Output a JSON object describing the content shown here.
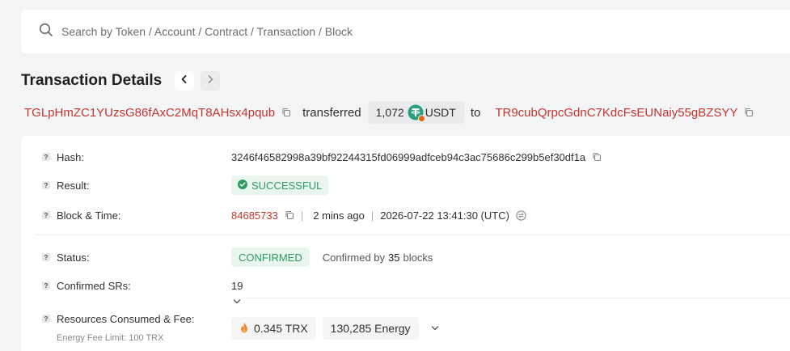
{
  "search": {
    "placeholder": "Search by Token / Account / Contract / Transaction / Block",
    "icon": "search-icon"
  },
  "header": {
    "title": "Transaction Details",
    "prev_icon": "chevron-left-icon",
    "next_icon": "chevron-right-icon"
  },
  "transfer": {
    "from": "TGLpHmZC1YUzsG86fAxC2MqT8AHsx4pqub",
    "verb": "transferred",
    "amount": "1,072",
    "token": "USDT",
    "to_word": "to",
    "to": "TR9cubQrpcGdnC7KdcFsEUNaiy55gBZSYY"
  },
  "details": {
    "hash": {
      "label": "Hash:",
      "value": "3246f46582998a39bf92244315fd06999adfceb94c3ac75686c299b5ef30df1a"
    },
    "result": {
      "label": "Result:",
      "value": "SUCCESSFUL"
    },
    "block_time": {
      "label": "Block & Time:",
      "block": "84685733",
      "ago": "2 mins ago",
      "datetime": "2026-07-22 13:41:30 (UTC)"
    },
    "status": {
      "label": "Status:",
      "value": "CONFIRMED",
      "confirmed_prefix": "Confirmed by",
      "confirmed_count": "35",
      "confirmed_suffix": "blocks"
    },
    "confirmed_srs": {
      "label": "Confirmed SRs:",
      "value": "19"
    },
    "resources": {
      "label": "Resources Consumed & Fee:",
      "sublabel": "Energy Fee Limit: 100 TRX",
      "trx": "0.345 TRX",
      "energy": "130,285 Energy"
    }
  },
  "colors": {
    "accent_red": "#c23631",
    "success_green": "#2e9c5d",
    "usdt_teal": "#26a17b",
    "background": "#f3f4f6"
  }
}
